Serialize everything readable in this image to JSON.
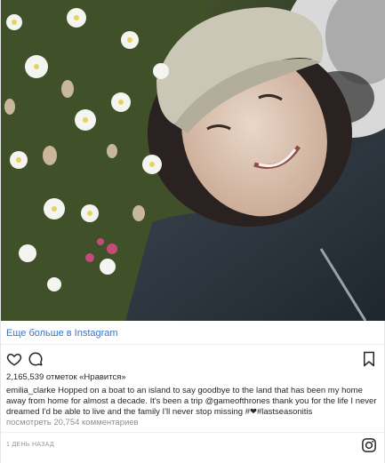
{
  "post": {
    "more_link": "Еще больше в Instagram",
    "likes": "2,165,539 отметок «Нравится»",
    "caption_user": "emilia_clarke",
    "caption_text": " Hopped on a boat to an island to say goodbye to the land that has been my home away from home for almost a decade. It's been a trip @gameofthrones thank you for the life I never dreamed I'd be able to live and the family I'll never stop missing #❤#lastseasonitis",
    "comments_link": "посмотреть 20,754 комментариев",
    "timestamp": "1 ДЕНЬ НАЗАД"
  },
  "icons": {
    "like": "heart-icon",
    "comment": "comment-icon",
    "save": "bookmark-icon",
    "brand": "instagram-icon"
  },
  "colors": {
    "link": "#3b74c4",
    "muted": "#8e8e8e",
    "text": "#262626"
  }
}
